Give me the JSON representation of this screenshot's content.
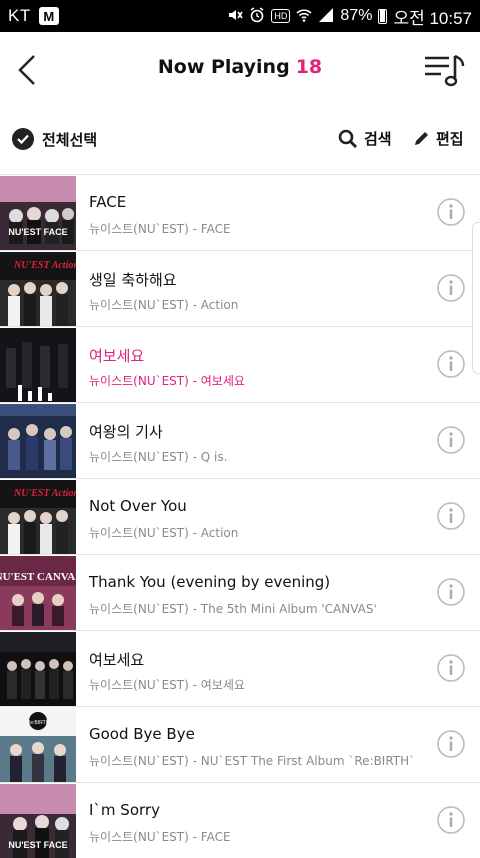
{
  "status_bar": {
    "carrier": "KT",
    "m_badge": "M",
    "hd": "HD",
    "battery": "87%",
    "time": "오전 10:57"
  },
  "header": {
    "title": "Now Playing",
    "count": "18",
    "accent_color": "#e0227a"
  },
  "toolbar": {
    "select_all_label": "전체선택",
    "search_label": "검색",
    "edit_label": "편집"
  },
  "tracks": [
    {
      "title": "FACE",
      "subtitle": "뉴이스트(NU`EST) - FACE"
    },
    {
      "title": "생일 축하해요",
      "subtitle": "뉴이스트(NU`EST) - Action"
    },
    {
      "title": "여보세요",
      "subtitle": "뉴이스트(NU`EST) - 여보세요"
    },
    {
      "title": "여왕의 기사",
      "subtitle": "뉴이스트(NU`EST) - Q is."
    },
    {
      "title": "Not Over You",
      "subtitle": "뉴이스트(NU`EST) - Action"
    },
    {
      "title": "Thank You (evening by evening)",
      "subtitle": "뉴이스트(NU`EST) - The 5th Mini Album 'CANVAS'"
    },
    {
      "title": "여보세요",
      "subtitle": "뉴이스트(NU`EST) - 여보세요"
    },
    {
      "title": "Good Bye Bye",
      "subtitle": "뉴이스트(NU`EST) - NU`EST The First Album `Re:BIRTH`"
    },
    {
      "title": "I`m Sorry",
      "subtitle": "뉴이스트(NU`EST) - FACE"
    }
  ],
  "album_art": [
    {
      "text": "NU'EST FACE"
    },
    {
      "text": "NU'EST Action"
    },
    {
      "text": ""
    },
    {
      "text": ""
    },
    {
      "text": "NU'EST Action"
    },
    {
      "text": "NU'EST CANVAS"
    },
    {
      "text": ""
    },
    {
      "text": "Re:BIRTH"
    },
    {
      "text": "NU'EST FACE"
    }
  ]
}
